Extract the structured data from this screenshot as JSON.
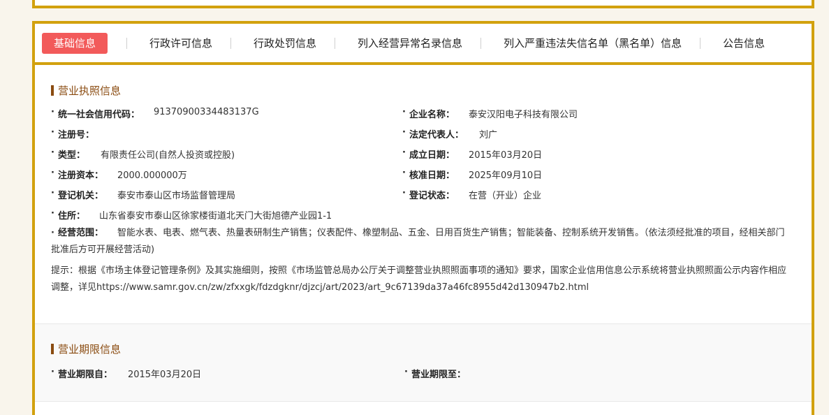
{
  "tabs": [
    {
      "label": "基础信息",
      "active": true
    },
    {
      "label": "行政许可信息",
      "active": false
    },
    {
      "label": "行政处罚信息",
      "active": false
    },
    {
      "label": "列入经营异常名录信息",
      "active": false
    },
    {
      "label": "列入严重违法失信名单（黑名单）信息",
      "active": false
    },
    {
      "label": "公告信息",
      "active": false
    }
  ],
  "license": {
    "title": "营业执照信息",
    "credit_code_label": "统一社会信用代码：",
    "credit_code": "91370900334483137G",
    "company_name_label": "企业名称：",
    "company_name": "泰安汉阳电子科技有限公司",
    "reg_no_label": "注册号：",
    "reg_no": "",
    "legal_rep_label": "法定代表人：",
    "legal_rep": "刘广",
    "type_label": "类型：",
    "type": "有限责任公司(自然人投资或控股)",
    "established_label": "成立日期：",
    "established": "2015年03月20日",
    "capital_label": "注册资本：",
    "capital": "2000.000000万",
    "approved_label": "核准日期：",
    "approved": "2025年09月10日",
    "authority_label": "登记机关：",
    "authority": "泰安市泰山区市场监督管理局",
    "status_label": "登记状态：",
    "status": "在营（开业）企业",
    "address_label": "住所：",
    "address": "山东省泰安市泰山区徐家楼街道北天门大街旭德产业园1-1",
    "scope_label": "经营范围：",
    "scope": "智能水表、电表、燃气表、热量表研制生产销售；仪表配件、橡塑制品、五金、日用百货生产销售；智能装备、控制系统开发销售。（依法须经批准的项目，经相关部门批准后方可开展经营活动)",
    "notice": "提示：根据《市场主体登记管理条例》及其实施细则，按照《市场监管总局办公厅关于调整营业执照照面事项的通知》要求，国家企业信用信息公示系统将营业执照照面公示内容作相应调整，详见https://www.samr.gov.cn/zw/zfxxgk/fdzdgknr/djzcj/art/2023/art_9c67139da37a46fc8955d42d130947b2.html"
  },
  "term": {
    "title": "营业期限信息",
    "from_label": "营业期限自：",
    "from": "2015年03月20日",
    "to_label": "营业期限至：",
    "to": ""
  }
}
